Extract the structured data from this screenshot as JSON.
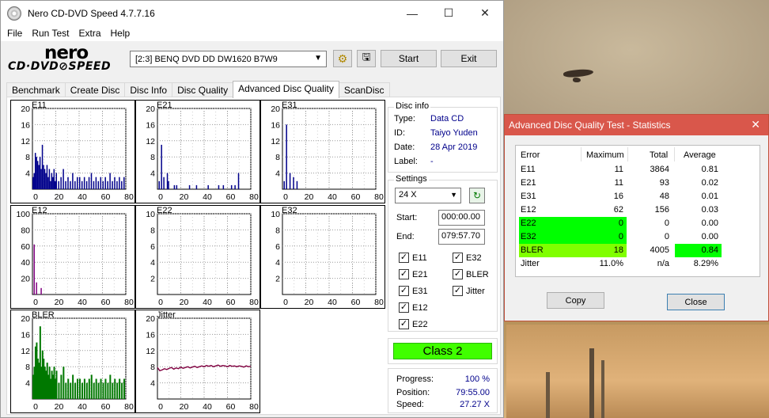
{
  "main_window": {
    "title": "Nero CD-DVD Speed 4.7.7.16",
    "menu": [
      "File",
      "Run Test",
      "Extra",
      "Help"
    ],
    "logo_brand": "nero",
    "logo_sub": "CD·DVD⊘SPEED",
    "drive": "[2:3]  BENQ DVD DD DW1620 B7W9",
    "buttons": {
      "start": "Start",
      "exit": "Exit"
    },
    "tabs": [
      "Benchmark",
      "Create Disc",
      "Disc Info",
      "Disc Quality",
      "Advanced Disc Quality",
      "ScanDisc"
    ],
    "active_tab": "Advanced Disc Quality"
  },
  "disc_info": {
    "heading": "Disc info",
    "type_label": "Type:",
    "type_value": "Data CD",
    "id_label": "ID:",
    "id_value": "Taiyo Yuden",
    "date_label": "Date:",
    "date_value": "28 Apr 2019",
    "label_label": "Label:",
    "label_value": "-"
  },
  "settings": {
    "heading": "Settings",
    "speed": "24 X",
    "start_label": "Start:",
    "start_value": "000:00.00",
    "end_label": "End:",
    "end_value": "079:57.70",
    "checks": [
      {
        "label": "E11",
        "checked": true
      },
      {
        "label": "E32",
        "checked": true
      },
      {
        "label": "E21",
        "checked": true
      },
      {
        "label": "BLER",
        "checked": true
      },
      {
        "label": "E31",
        "checked": true
      },
      {
        "label": "Jitter",
        "checked": true
      },
      {
        "label": "E12",
        "checked": true
      },
      {
        "label": "E22",
        "checked": true
      }
    ]
  },
  "class_badge": "Class 2",
  "progress": {
    "progress_label": "Progress:",
    "progress_value": "100 %",
    "position_label": "Position:",
    "position_value": "79:55.00",
    "speed_label": "Speed:",
    "speed_value": "27.27 X"
  },
  "chart_data": [
    {
      "type": "bar",
      "title": "E11",
      "yticks": [
        "20",
        "16",
        "12",
        "8",
        "4"
      ],
      "xticks": [
        "0",
        "20",
        "40",
        "60",
        "80"
      ],
      "ylim": [
        0,
        20
      ],
      "xlim": [
        0,
        80
      ],
      "x": [
        0,
        1,
        2,
        3,
        4,
        5,
        6,
        7,
        8,
        9,
        10,
        11,
        12,
        13,
        14,
        15,
        16,
        17,
        18,
        19,
        20,
        22,
        24,
        26,
        28,
        30,
        32,
        34,
        36,
        38,
        40,
        42,
        44,
        46,
        48,
        50,
        52,
        54,
        56,
        58,
        60,
        62,
        64,
        66,
        68,
        70,
        72,
        74,
        76,
        78
      ],
      "values": [
        3,
        4,
        9,
        8,
        7,
        6,
        8,
        5,
        11,
        6,
        5,
        4,
        6,
        3,
        5,
        2,
        4,
        3,
        5,
        2,
        4,
        2,
        3,
        5,
        2,
        3,
        2,
        4,
        2,
        3,
        3,
        2,
        3,
        2,
        3,
        4,
        2,
        3,
        2,
        3,
        2,
        3,
        2,
        4,
        2,
        3,
        2,
        3,
        2,
        3
      ]
    },
    {
      "type": "bar",
      "title": "E21",
      "yticks": [
        "20",
        "16",
        "12",
        "8",
        "4"
      ],
      "xticks": [
        "0",
        "20",
        "40",
        "60",
        "80"
      ],
      "ylim": [
        0,
        20
      ],
      "xlim": [
        0,
        80
      ],
      "x": [
        1,
        3,
        5,
        8,
        9,
        14,
        16,
        27,
        33,
        43,
        52,
        56,
        63,
        66,
        69
      ],
      "values": [
        2,
        11,
        3,
        4,
        2,
        1,
        1,
        1,
        1,
        1,
        1,
        1,
        1,
        1,
        4
      ]
    },
    {
      "type": "bar",
      "title": "E31",
      "yticks": [
        "20",
        "16",
        "12",
        "8",
        "4"
      ],
      "xticks": [
        "0",
        "20",
        "40",
        "60",
        "80"
      ],
      "ylim": [
        0,
        20
      ],
      "xlim": [
        0,
        80
      ],
      "x": [
        1,
        3,
        6,
        9,
        12
      ],
      "values": [
        2,
        16,
        4,
        3,
        2
      ]
    },
    {
      "type": "bar",
      "title": "E12",
      "yticks": [
        "100",
        "80",
        "60",
        "40",
        "20"
      ],
      "xticks": [
        "0",
        "20",
        "40",
        "60",
        "80"
      ],
      "ylim": [
        0,
        100
      ],
      "xlim": [
        0,
        80
      ],
      "x": [
        1,
        3,
        7
      ],
      "values": [
        62,
        15,
        8
      ]
    },
    {
      "type": "bar",
      "title": "E22",
      "yticks": [
        "10",
        "8",
        "6",
        "4",
        "2"
      ],
      "xticks": [
        "0",
        "20",
        "40",
        "60",
        "80"
      ],
      "ylim": [
        0,
        10
      ],
      "xlim": [
        0,
        80
      ],
      "x": [],
      "values": []
    },
    {
      "type": "bar",
      "title": "E32",
      "yticks": [
        "10",
        "8",
        "6",
        "4",
        "2"
      ],
      "xticks": [
        "0",
        "20",
        "40",
        "60",
        "80"
      ],
      "ylim": [
        0,
        10
      ],
      "xlim": [
        0,
        80
      ],
      "x": [],
      "values": []
    },
    {
      "type": "bar",
      "title": "BLER",
      "yticks": [
        "20",
        "16",
        "12",
        "8",
        "4"
      ],
      "xticks": [
        "0",
        "20",
        "40",
        "60",
        "80"
      ],
      "ylim": [
        0,
        20
      ],
      "xlim": [
        0,
        80
      ],
      "x": [
        0,
        1,
        2,
        3,
        4,
        5,
        6,
        7,
        8,
        9,
        10,
        11,
        12,
        13,
        14,
        15,
        16,
        17,
        18,
        19,
        20,
        22,
        24,
        26,
        28,
        30,
        32,
        34,
        36,
        38,
        40,
        42,
        44,
        46,
        48,
        50,
        52,
        54,
        56,
        58,
        60,
        62,
        64,
        66,
        68,
        70,
        72,
        74,
        76,
        78
      ],
      "values": [
        6,
        8,
        13,
        14,
        10,
        9,
        18,
        8,
        12,
        10,
        8,
        7,
        9,
        6,
        8,
        5,
        7,
        6,
        8,
        5,
        7,
        4,
        6,
        8,
        4,
        5,
        4,
        6,
        4,
        5,
        5,
        4,
        5,
        4,
        5,
        6,
        4,
        5,
        4,
        5,
        4,
        5,
        4,
        6,
        4,
        5,
        4,
        5,
        4,
        5
      ]
    },
    {
      "type": "line",
      "title": "Jitter",
      "yticks": [
        "20",
        "16",
        "12",
        "8",
        "4"
      ],
      "xticks": [
        "0",
        "20",
        "40",
        "60",
        "80"
      ],
      "ylim": [
        0,
        20
      ],
      "xlim": [
        0,
        80
      ],
      "x": [
        0,
        2,
        4,
        6,
        8,
        10,
        12,
        14,
        16,
        18,
        20,
        22,
        24,
        26,
        28,
        30,
        32,
        34,
        36,
        38,
        40,
        42,
        44,
        46,
        48,
        50,
        52,
        54,
        56,
        58,
        60,
        62,
        64,
        66,
        68,
        70,
        72,
        74,
        76,
        78,
        80
      ],
      "values": [
        7.8,
        7.0,
        7.2,
        7.5,
        7.3,
        7.6,
        7.8,
        7.4,
        7.7,
        7.5,
        7.9,
        7.6,
        7.8,
        8.0,
        7.7,
        7.9,
        8.1,
        7.8,
        8.0,
        8.2,
        8.0,
        8.3,
        8.1,
        8.3,
        8.0,
        8.2,
        8.4,
        8.1,
        8.3,
        8.2,
        8.0,
        8.3,
        8.1,
        8.2,
        8.0,
        8.2,
        8.1,
        7.9,
        8.2,
        8.0,
        8.1
      ]
    }
  ],
  "stats_window": {
    "title": "Advanced Disc Quality Test - Statistics",
    "headers": [
      "Error",
      "Maximum",
      "Total",
      "Average"
    ],
    "rows": [
      {
        "error": "E11",
        "maximum": "11",
        "total": "3864",
        "average": "0.81",
        "hl_left": false,
        "hl_avg": false
      },
      {
        "error": "E21",
        "maximum": "11",
        "total": "93",
        "average": "0.02",
        "hl_left": false,
        "hl_avg": false
      },
      {
        "error": "E31",
        "maximum": "16",
        "total": "48",
        "average": "0.01",
        "hl_left": false,
        "hl_avg": false
      },
      {
        "error": "E12",
        "maximum": "62",
        "total": "156",
        "average": "0.03",
        "hl_left": false,
        "hl_avg": false
      },
      {
        "error": "E22",
        "maximum": "0",
        "total": "0",
        "average": "0.00",
        "hl_left": true,
        "hl_avg": false
      },
      {
        "error": "E32",
        "maximum": "0",
        "total": "0",
        "average": "0.00",
        "hl_left": true,
        "hl_avg": false
      },
      {
        "error": "BLER",
        "maximum": "18",
        "total": "4005",
        "average": "0.84",
        "hl_left": true,
        "hl_avg": true
      },
      {
        "error": "Jitter",
        "maximum": "11.0%",
        "total": "n/a",
        "average": "8.29%",
        "hl_left": false,
        "hl_avg": false
      }
    ],
    "copy_button": "Copy",
    "close_button": "Close"
  },
  "colors": {
    "bar_color": "#00008b",
    "bler_color": "#007800",
    "e12_color": "#800080",
    "jitter_color": "#800040",
    "grid_color": "#00b4b4",
    "highlight_green": "#00ff00",
    "highlight_bler": "#80ff00",
    "class_green": "#40ff00",
    "stats_title_red": "#d9574b"
  }
}
